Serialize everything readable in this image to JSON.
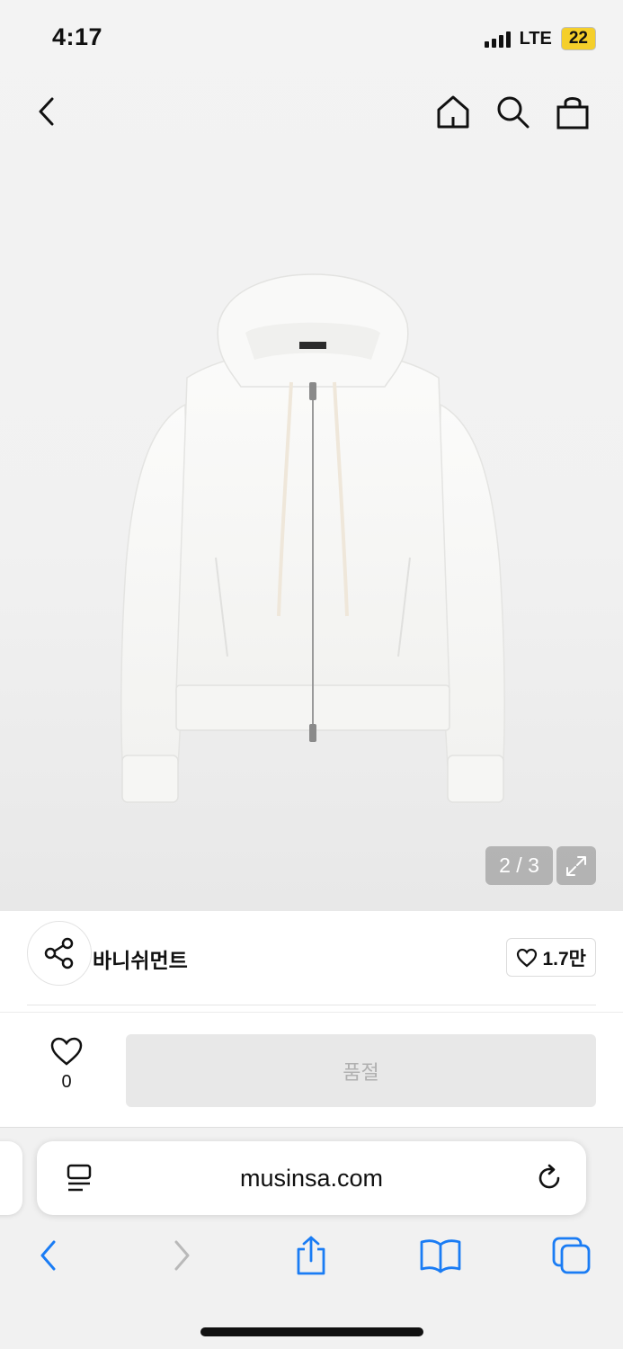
{
  "status_bar": {
    "time": "4:17",
    "network": "LTE",
    "battery": "22"
  },
  "nav": {
    "back_icon": "chevron-left-icon",
    "home_icon": "home-icon",
    "search_icon": "search-icon",
    "cart_icon": "shopping-bag-icon"
  },
  "gallery": {
    "counter": "2 / 3",
    "expand_icon": "expand-icon",
    "product_color": "#f7f7f5"
  },
  "brand": {
    "name": "바니쉬먼트",
    "likes": "1.7만",
    "share_icon": "share-icon"
  },
  "buy": {
    "wish_count": "0",
    "button_label": "품절"
  },
  "browser": {
    "url": "musinsa.com",
    "accent": "#1a7cf4",
    "toolbar": [
      "back",
      "forward",
      "share",
      "bookmarks",
      "tabs"
    ]
  }
}
